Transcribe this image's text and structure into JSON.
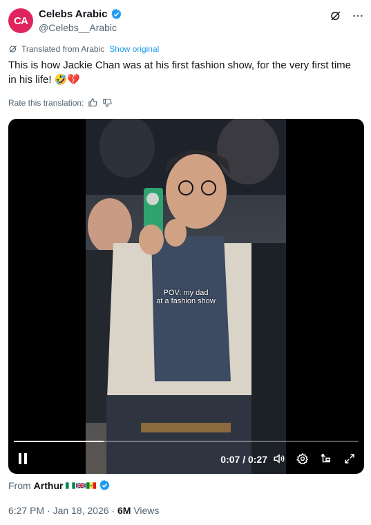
{
  "account": {
    "display_name": "Celebs Arabic",
    "handle": "@Celebs__Arabic",
    "avatar_text": "CA",
    "avatar_color": "#e0245e",
    "verified_color": "#1d9bf0"
  },
  "translation": {
    "label": "Translated from Arabic",
    "show_original": "Show original",
    "rate_label": "Rate this translation:"
  },
  "tweet": {
    "text": "This is how Jackie Chan was at his first fashion show, for the very first time in his life! 🤣💔"
  },
  "video": {
    "caption": "POV: my dad\nat a fashion show",
    "time": "0:07 / 0:27",
    "progress": 0.26
  },
  "source": {
    "prefix": "From",
    "name": "Arthur",
    "flags": [
      "nigeria-flag",
      "uk-flag",
      "senegal-flag"
    ]
  },
  "meta": {
    "time_date": "6:27 PM · Jan 18, 2026 ·",
    "views_count": "6M",
    "views_label": "Views"
  }
}
